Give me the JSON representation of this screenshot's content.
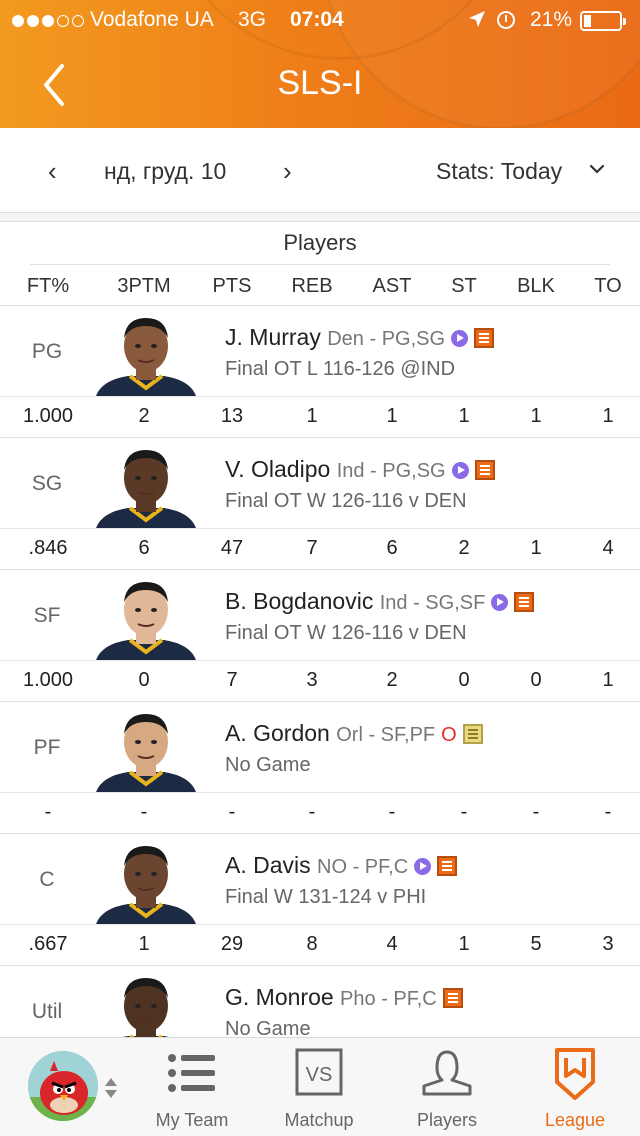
{
  "status_bar": {
    "carrier": "Vodafone UA",
    "network": "3G",
    "time": "07:04",
    "battery_percent": "21%",
    "battery_level": 0.21,
    "signal_dots_filled": 3,
    "signal_dots_total": 5
  },
  "header": {
    "title": "SLS-I"
  },
  "datebar": {
    "date": "нд, груд. 10",
    "stats_label": "Stats: Today"
  },
  "table": {
    "section_title": "Players",
    "columns": [
      "FT%",
      "3PTM",
      "PTS",
      "REB",
      "AST",
      "ST",
      "BLK",
      "TO"
    ]
  },
  "players": [
    {
      "pos": "PG",
      "name": "J. Murray",
      "team": "Den - PG,SG",
      "game": "Final OT L 116-126 @IND",
      "badges": [
        "play",
        "note"
      ],
      "stats": [
        "1.000",
        "2",
        "13",
        "1",
        "1",
        "1",
        "1",
        "1"
      ]
    },
    {
      "pos": "SG",
      "name": "V. Oladipo",
      "team": "Ind - PG,SG",
      "game": "Final OT W 126-116 v DEN",
      "badges": [
        "play",
        "note"
      ],
      "stats": [
        ".846",
        "6",
        "47",
        "7",
        "6",
        "2",
        "1",
        "4"
      ]
    },
    {
      "pos": "SF",
      "name": "B. Bogdanovic",
      "team": "Ind - SG,SF",
      "game": "Final OT W 126-116 v DEN",
      "badges": [
        "play",
        "note"
      ],
      "stats": [
        "1.000",
        "0",
        "7",
        "3",
        "2",
        "0",
        "0",
        "1"
      ]
    },
    {
      "pos": "PF",
      "name": "A. Gordon",
      "team": "Orl - SF,PF",
      "game": "No Game",
      "badges": [
        "o",
        "note-gray"
      ],
      "o_label": "O",
      "stats": [
        "-",
        "-",
        "-",
        "-",
        "-",
        "-",
        "-",
        "-"
      ]
    },
    {
      "pos": "C",
      "name": "A. Davis",
      "team": "NO - PF,C",
      "game": "Final W 131-124 v PHI",
      "badges": [
        "play",
        "note"
      ],
      "stats": [
        ".667",
        "1",
        "29",
        "8",
        "4",
        "1",
        "5",
        "3"
      ]
    },
    {
      "pos": "Util",
      "name": "G. Monroe",
      "team": "Pho - PF,C",
      "game": "No Game",
      "badges": [
        "note"
      ],
      "stats": []
    }
  ],
  "tabbar": {
    "tabs": [
      {
        "label": "My Team",
        "icon": "list-icon"
      },
      {
        "label": "Matchup",
        "icon": "vs-icon"
      },
      {
        "label": "Players",
        "icon": "person-icon"
      },
      {
        "label": "League",
        "icon": "league-shield-icon"
      }
    ],
    "active_tab": "League",
    "colors": {
      "accent": "#ea6b18",
      "inactive": "#666666"
    }
  },
  "colors": {
    "header_start": "#f29a1f",
    "header_end": "#ea6a14",
    "accent": "#ea6b18"
  }
}
